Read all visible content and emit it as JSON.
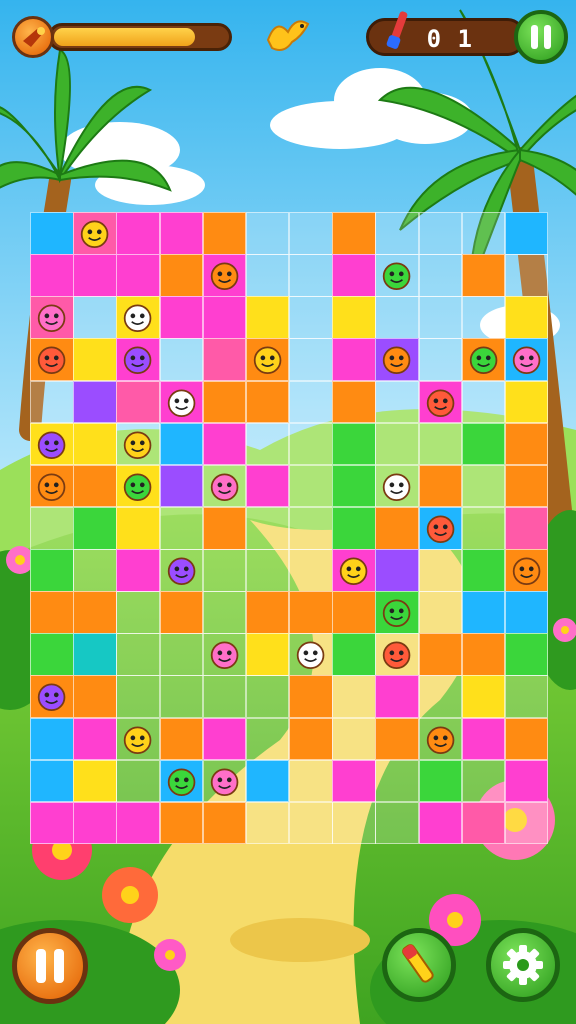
{
  "hud": {
    "level_label": "",
    "counter_text": "0 1",
    "progress_fraction": 0.82
  },
  "colors": {
    "sky_top": "#4fc3f0",
    "sky_bottom": "#bfe9fb",
    "grass": "#6cc62e",
    "path": "#f3d55b",
    "gold_frame": "#e89a1a",
    "green_button": "#3dbf2e",
    "orange_button": "#f57c12"
  },
  "puzzle": {
    "palette": [
      "#ff3fd0",
      "#ff8b12",
      "#1fb6ff",
      "#ffe01b",
      "#3bd63b",
      "#9b4dff",
      "#ff5aa8",
      "#16c8c4"
    ],
    "cells": [
      "2a0m1xx1xxx2",
      "00m10xx0xx1x",
      "6x30m3x3xxx3",
      "130x61x05x12",
      "x56011x1x0x3",
      "33x20xx4xx41",
      "1c35x0x4x1x1",
      "x43x1xx412x6",
      "4x0xxxx05x41",
      "11x1x1114x22",
      "47xxx3x4x114",
      "11xxxx1x0x3x",
      "20x10x1x1x01",
      "23x2x2x0x4x0",
      "00011xxxx06x"
    ],
    "critter_icons": [
      "heart-face-icon",
      "fox-face-icon",
      "bird-face-icon",
      "smiley-face-icon",
      "pig-face-icon",
      "cat-face-icon",
      "owl-face-icon",
      "bunny-face-icon",
      "frog-face-icon",
      "fish-face-icon",
      "flower-pot-icon",
      "bird-spinning-icon",
      "puppy-face-icon",
      "penguin-face-icon",
      "monster-face-icon"
    ]
  }
}
